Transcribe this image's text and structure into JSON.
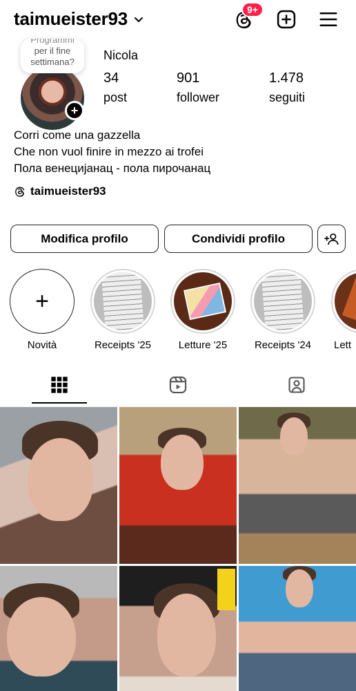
{
  "header": {
    "username": "taimueister93",
    "notifications_badge": "9+"
  },
  "profile": {
    "display_name": "Nicola",
    "note_lines": [
      "Programmi",
      "per il fine",
      "settimana?"
    ],
    "stats": {
      "posts_value": "34",
      "posts_label": "post",
      "followers_value": "901",
      "followers_label": "follower",
      "following_value": "1.478",
      "following_label": "seguiti"
    },
    "bio_lines": [
      "Corri come una gazzella",
      "Che non vuol finire in mezzo ai trofei",
      "Пола венецијанац - пола пирочанац"
    ],
    "threads_handle": "taimueister93"
  },
  "actions": {
    "edit_label": "Modifica profilo",
    "share_label": "Condividi profilo"
  },
  "highlights": [
    {
      "label": "Novità"
    },
    {
      "label": "Receipts '25"
    },
    {
      "label": "Letture '25"
    },
    {
      "label": "Receipts '24"
    },
    {
      "label": "Lett"
    }
  ],
  "tabs": [
    "posts-grid-icon",
    "reels-icon",
    "tagged-icon"
  ],
  "colors": {
    "badge": "#ff1f4b",
    "text": "#000000",
    "border": "#222222"
  }
}
